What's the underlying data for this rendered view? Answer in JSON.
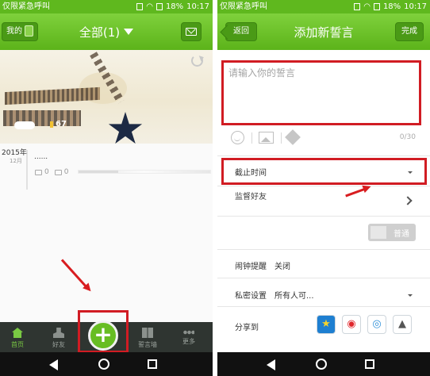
{
  "status_bar": {
    "carrier": "仅限紧急呼叫",
    "battery": "18%",
    "time": "10:17"
  },
  "left_screen": {
    "header": {
      "mine_label": "我的",
      "title": "全部(1)"
    },
    "cover": {
      "like_count": "67"
    },
    "feed_item": {
      "year": "2015年",
      "month": "12月",
      "text": "......",
      "image_count": "0",
      "comment_count": "0",
      "progress": 0.3
    },
    "tabs": [
      {
        "label": "首页"
      },
      {
        "label": "好友"
      },
      {
        "label": "誓言墙"
      },
      {
        "label": "更多"
      }
    ],
    "add_button_glyph": "+"
  },
  "right_screen": {
    "header": {
      "back_label": "返回",
      "title": "添加新誓言",
      "done_label": "完成"
    },
    "input": {
      "placeholder": "请输入你的誓言",
      "char_count": "0/30"
    },
    "deadline": {
      "label": "截止时间"
    },
    "partial_row": {
      "label": "监督好友"
    },
    "toggle": {
      "label": "普通"
    },
    "alarm": {
      "label": "闹钟提醒",
      "value": "关闭"
    },
    "privacy": {
      "label": "私密设置",
      "value": "所有人可..."
    },
    "share": {
      "label": "分享到"
    }
  },
  "colors": {
    "brand_green": "#5fb81e",
    "highlight_red": "#d11c23",
    "tab_bar": "#2f3531"
  }
}
